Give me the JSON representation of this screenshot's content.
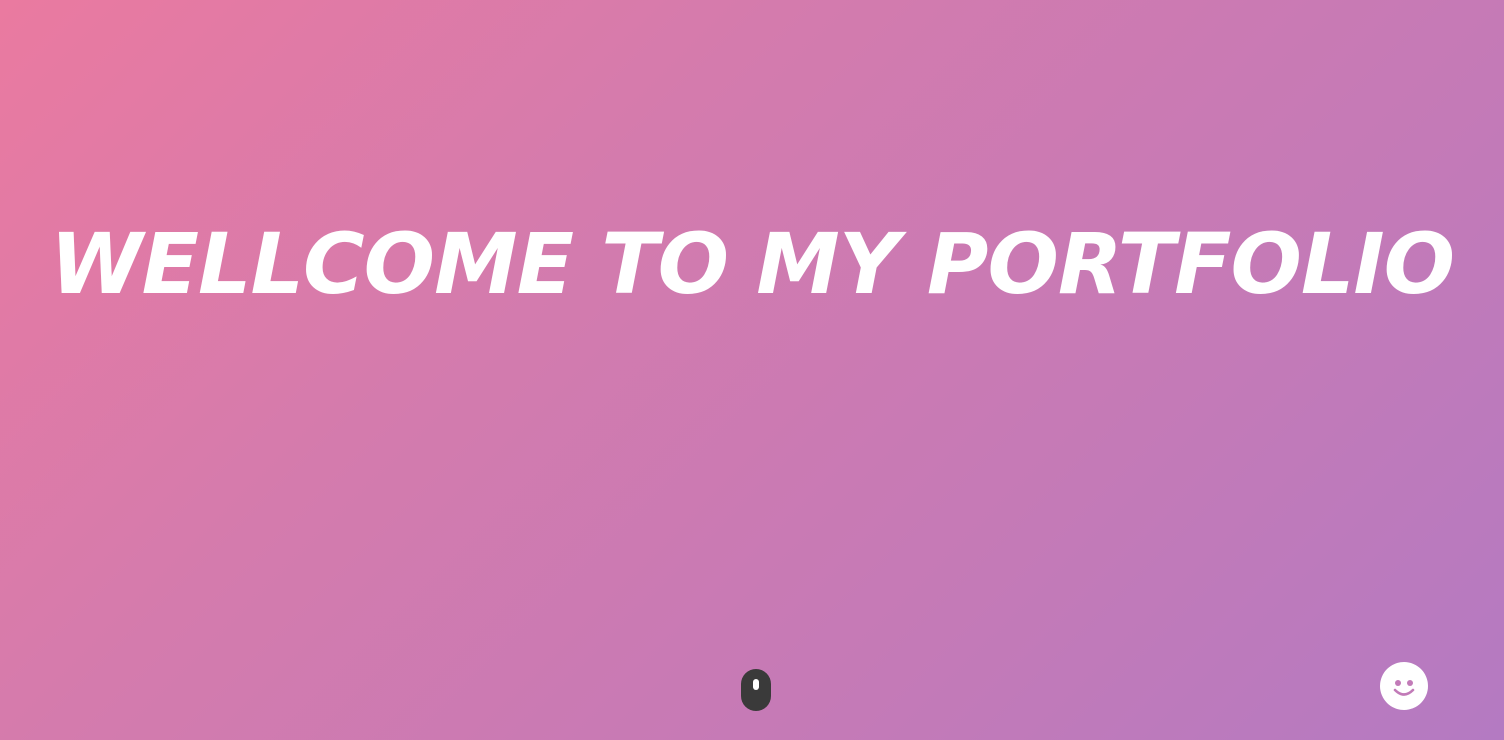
{
  "hero": {
    "title": "WELLCOME TO MY PORTFOLIO"
  },
  "scroll_indicator": {
    "icon": "mouse-scroll-icon"
  },
  "floating_button": {
    "icon": "smiley-face-icon"
  },
  "colors": {
    "gradient_start": "#ea7aa0",
    "gradient_end": "#b47ac2",
    "title_text": "#ffffff",
    "scroll_indicator": "#3a3a3a",
    "smiley_button": "#ffffff",
    "smiley_face": "#c27bb8"
  }
}
